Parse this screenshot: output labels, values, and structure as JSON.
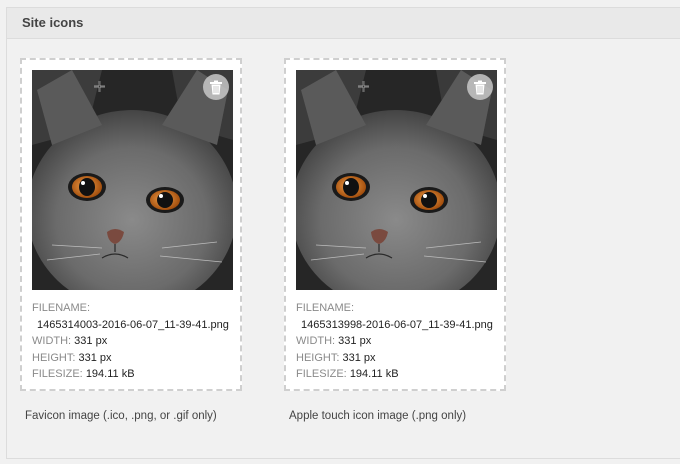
{
  "panel": {
    "title": "Site icons"
  },
  "icons": [
    {
      "filename_label": "FILENAME:",
      "filename": "1465314003-2016-06-07_11-39-41.png",
      "width_label": "WIDTH:",
      "width": "331 px",
      "height_label": "HEIGHT:",
      "height": "331 px",
      "filesize_label": "FILESIZE:",
      "filesize": "194.11 kB",
      "caption": "Favicon image (.ico, .png, or .gif only)"
    },
    {
      "filename_label": "FILENAME:",
      "filename": "1465313998-2016-06-07_11-39-41.png",
      "width_label": "WIDTH:",
      "width": "331 px",
      "height_label": "HEIGHT:",
      "height": "331 px",
      "filesize_label": "FILESIZE:",
      "filesize": "194.11 kB",
      "caption": "Apple touch icon image (.png only)"
    }
  ],
  "icons_meta": {
    "delete_icon": "trash-icon",
    "image_subject": "cat-photo"
  }
}
